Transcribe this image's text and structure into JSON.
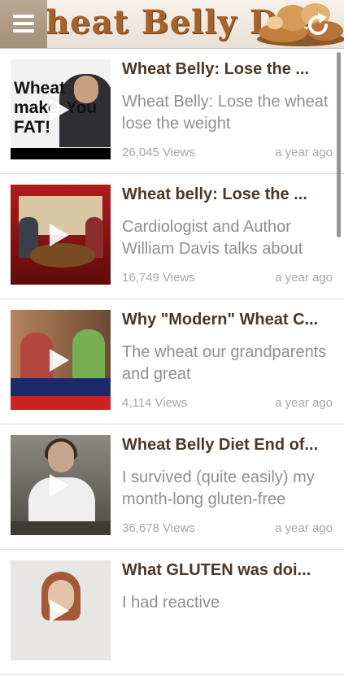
{
  "header": {
    "title": "Wheat Belly Diet",
    "menu_icon": "hamburger-menu-icon",
    "refresh_icon": "refresh-icon",
    "title_color": "#a5622b"
  },
  "videos": [
    {
      "title": "Wheat Belly: Lose the ...",
      "description": "Wheat Belly: Lose the wheat lose the weight",
      "views": "26,045 Views",
      "date": "a year ago",
      "thumbnail_text": [
        "Wheat",
        "make",
        "You",
        "FAT!"
      ]
    },
    {
      "title": "Wheat belly: Lose the ...",
      "description": "Cardiologist and Author William Davis talks about",
      "views": "16,749 Views",
      "date": "a year ago"
    },
    {
      "title": "Why \"Modern\" Wheat C...",
      "description": "The wheat our grandparents and great",
      "views": "4,114 Views",
      "date": "a year ago"
    },
    {
      "title": "Wheat Belly Diet End of...",
      "description": "I survived (quite easily) my month-long gluten-free",
      "views": "36,678 Views",
      "date": "a year ago"
    },
    {
      "title": "What GLUTEN was doi...",
      "description": "I had reactive",
      "views": "",
      "date": ""
    }
  ]
}
